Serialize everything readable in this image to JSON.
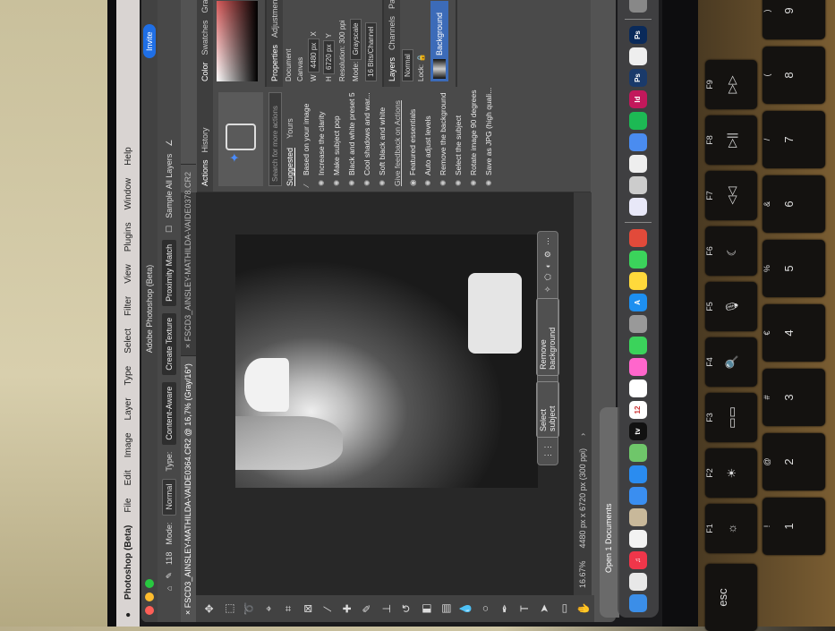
{
  "menubar": {
    "app": "Photoshop (Beta)",
    "items": [
      "File",
      "Edit",
      "Image",
      "Layer",
      "Type",
      "Select",
      "Filter",
      "View",
      "Plugins",
      "Window",
      "Help"
    ]
  },
  "window": {
    "title": "Adobe Photoshop (Beta)",
    "invite": "Invite"
  },
  "options": {
    "brush_size": "118",
    "mode_label": "Mode:",
    "mode_value": "Normal",
    "type_label": "Type:",
    "type_options": [
      "Content-Aware",
      "Create Texture",
      "Proximity Match"
    ],
    "sample_all_layers": "Sample All Layers"
  },
  "tabs": [
    "FSCD3_AINSLEY-MATHILDA-VAIDE0364.CR2 @ 16,7% (Gray/16*)",
    "FSCD3_AINSLEY-MATHILDA-VAIDE0378.CR2"
  ],
  "context_bar": {
    "select_subject": "Select subject",
    "remove_background": "Remove background"
  },
  "status": {
    "zoom": "16.67%",
    "size": "4480 px x 6720 px (300 ppi)"
  },
  "actions_panel": {
    "tabs": [
      "Actions",
      "History"
    ],
    "search_placeholder": "Search for more actions",
    "subtabs": [
      "Suggested",
      "Yours"
    ],
    "based_label": "Based on your image",
    "suggested": [
      "Increase the clarity",
      "Make subject pop",
      "Black and white preset 5",
      "Cool shadows and war...",
      "Soft black and white"
    ],
    "feedback": "Give feedback on Actions",
    "featured_label": "Featured essentials",
    "featured": [
      "Auto adjust levels",
      "Remove the background",
      "Select the subject",
      "Rotate image 90 degrees",
      "Save as JPG (high quali..."
    ]
  },
  "color_panel": {
    "tabs": [
      "Color",
      "Swatches",
      "Gradients"
    ]
  },
  "properties_panel": {
    "tabs": [
      "Properties",
      "Adjustments"
    ],
    "document": "Document",
    "canvas": "Canvas",
    "w_label": "W",
    "w": "4480 px",
    "h_label": "H",
    "h": "6720 px",
    "x_label": "X",
    "y_label": "Y",
    "resolution": "Resolution: 300 ppi",
    "mode_label": "Mode:",
    "mode": "Grayscale",
    "depth": "16 Bits/Channel"
  },
  "layers_panel": {
    "tabs": [
      "Layers",
      "Channels",
      "Paths"
    ],
    "blend": "Normal",
    "lock": "Lock:",
    "layer": "Background"
  },
  "dock": {
    "popup": "Open 1 Documents",
    "apps": [
      {
        "name": "finder",
        "color": "#3b8ee8",
        "g": ""
      },
      {
        "name": "launchpad",
        "color": "#e8e8e8",
        "g": ""
      },
      {
        "name": "music",
        "color": "#f0364a",
        "g": "♫"
      },
      {
        "name": "freeform",
        "color": "#f2f2f2",
        "g": ""
      },
      {
        "name": "contacts",
        "color": "#c8b89a",
        "g": ""
      },
      {
        "name": "mail",
        "color": "#3a8ef0",
        "g": ""
      },
      {
        "name": "safari",
        "color": "#2a8cf0",
        "g": ""
      },
      {
        "name": "maps",
        "color": "#6fc66a",
        "g": ""
      },
      {
        "name": "tv",
        "color": "#111",
        "g": "tv"
      },
      {
        "name": "calendar",
        "color": "#fff",
        "g": "12"
      },
      {
        "name": "reminders",
        "color": "#fff",
        "g": ""
      },
      {
        "name": "photos",
        "color": "#f6c",
        "g": ""
      },
      {
        "name": "messages",
        "color": "#3bd35b",
        "g": ""
      },
      {
        "name": "system-settings",
        "color": "#999",
        "g": ""
      },
      {
        "name": "app-store",
        "color": "#1d8ff0",
        "g": "A"
      },
      {
        "name": "notes",
        "color": "#ffd93b",
        "g": ""
      },
      {
        "name": "facetime",
        "color": "#3bd35b",
        "g": ""
      },
      {
        "name": "chrome",
        "color": "#e24a3a",
        "g": ""
      },
      {
        "name": "sep"
      },
      {
        "name": "arc",
        "color": "#e8e8f8",
        "g": ""
      },
      {
        "name": "preview",
        "color": "#ccc",
        "g": ""
      },
      {
        "name": "cursor",
        "color": "#eee",
        "g": ""
      },
      {
        "name": "zoom",
        "color": "#4a8cf0",
        "g": ""
      },
      {
        "name": "spotify",
        "color": "#1db954",
        "g": ""
      },
      {
        "name": "indesign",
        "color": "#c2185b",
        "g": "Id"
      },
      {
        "name": "photoshop",
        "color": "#1a3a6a",
        "g": "Ps"
      },
      {
        "name": "notes-2",
        "color": "#eee",
        "g": ""
      },
      {
        "name": "photoshop-beta",
        "color": "#0a2a5a",
        "g": "Ps"
      },
      {
        "name": "sep"
      },
      {
        "name": "trash",
        "color": "#888",
        "g": ""
      }
    ]
  },
  "keyboard": {
    "fn_row": [
      {
        "main": "esc",
        "sub": ""
      },
      {
        "main": "☼",
        "sub": "F1"
      },
      {
        "main": "☀",
        "sub": "F2"
      },
      {
        "main": "▭▭",
        "sub": "F3"
      },
      {
        "main": "🔍",
        "sub": "F4"
      },
      {
        "main": "🎙",
        "sub": "F5"
      },
      {
        "main": "☾",
        "sub": "F6"
      },
      {
        "main": "◁◁",
        "sub": "F7"
      },
      {
        "main": "▷||",
        "sub": "F8"
      },
      {
        "main": "▷▷",
        "sub": "F9"
      }
    ],
    "num_row": [
      {
        "main": "1",
        "sub": "!"
      },
      {
        "main": "2",
        "sub": "@"
      },
      {
        "main": "3",
        "sub": "#"
      },
      {
        "main": "4",
        "sub": "€"
      },
      {
        "main": "5",
        "sub": "%"
      },
      {
        "main": "6",
        "sub": "&"
      },
      {
        "main": "7",
        "sub": "/"
      },
      {
        "main": "8",
        "sub": "("
      },
      {
        "main": "9",
        "sub": ")"
      }
    ]
  }
}
